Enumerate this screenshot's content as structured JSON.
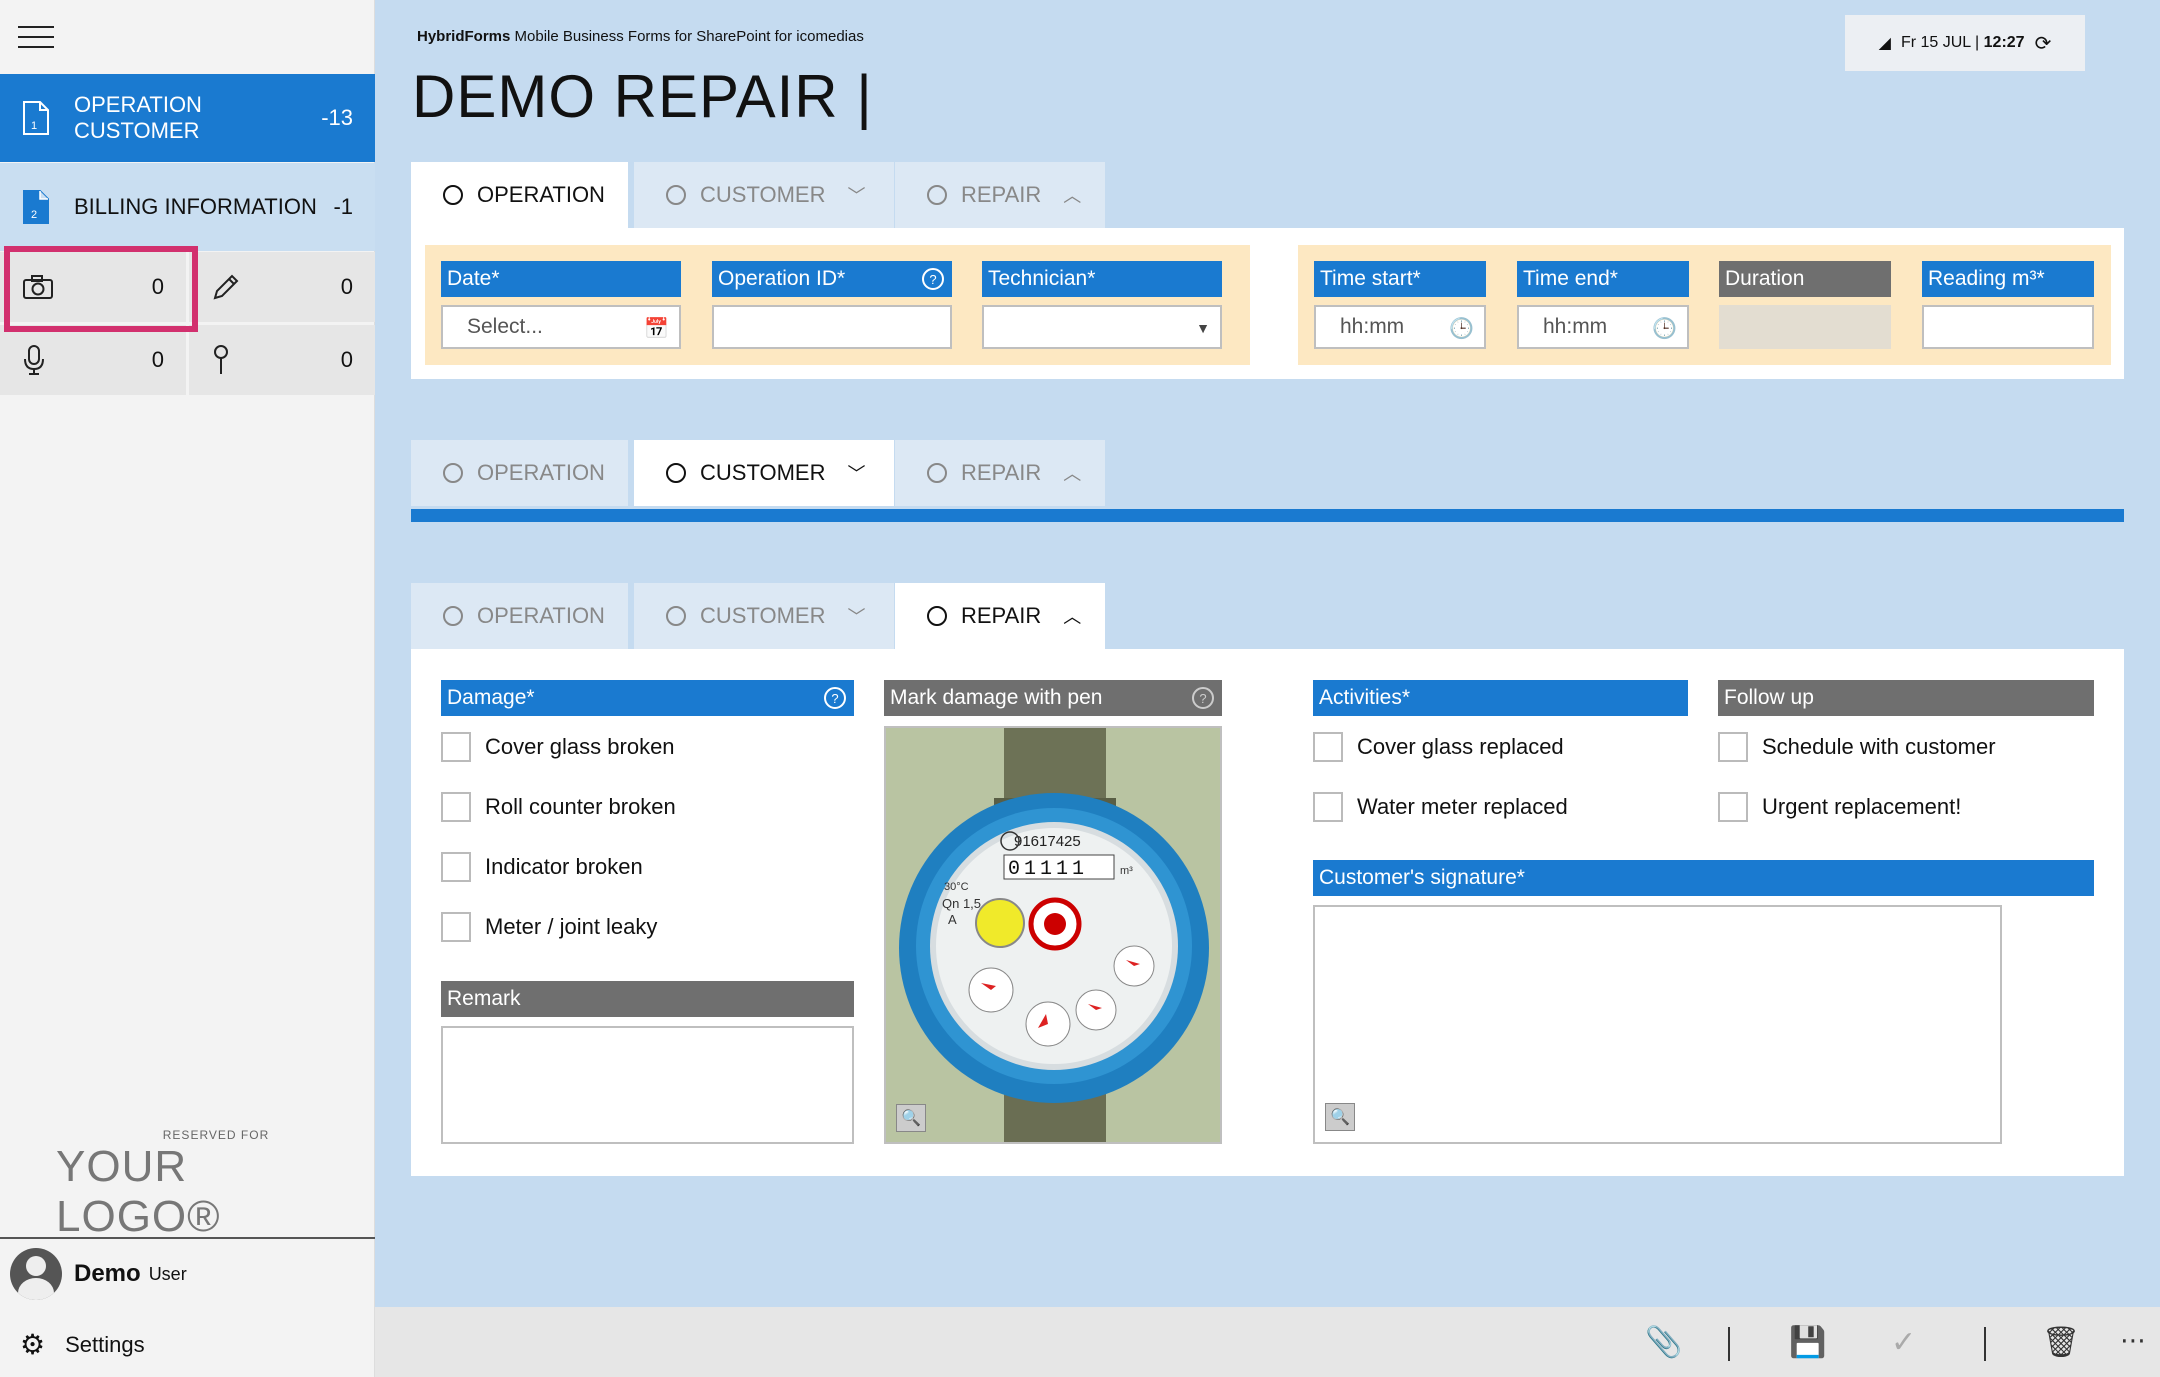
{
  "sidebar": {
    "nav": [
      {
        "num": "1",
        "label": "OPERATION CUSTOMER",
        "count": "-13"
      },
      {
        "num": "2",
        "label": "BILLING INFORMATION",
        "count": "-1"
      }
    ],
    "counters": {
      "camera": "0",
      "pen": "0",
      "mic": "0",
      "pin": "0"
    },
    "logo": {
      "small": "RESERVED FOR",
      "big": "YOUR LOGO®"
    },
    "user": {
      "name": "Demo",
      "role": "User"
    },
    "settings_label": "Settings"
  },
  "header": {
    "brand_bold": "HybridForms",
    "brand_rest": " Mobile Business Forms for SharePoint for icomedias",
    "title": "DEMO REPAIR |",
    "status_date": "Fr 15 JUL | ",
    "status_time": "12:27"
  },
  "tabs": {
    "operation": "OPERATION",
    "customer": "CUSTOMER",
    "repair": "REPAIR"
  },
  "operation": {
    "date_label": "Date*",
    "date_placeholder": "Select...",
    "opid_label": "Operation ID*",
    "tech_label": "Technician*",
    "time_start_label": "Time start*",
    "time_end_label": "Time end*",
    "time_placeholder": "hh:mm",
    "duration_label": "Duration",
    "reading_label": "Reading m³*"
  },
  "repair": {
    "damage_label": "Damage*",
    "damage_options": [
      "Cover glass broken",
      "Roll counter broken",
      "Indicator broken",
      "Meter / joint leaky"
    ],
    "remark_label": "Remark",
    "mark_label": "Mark damage with pen",
    "activities_label": "Activities*",
    "activities_options": [
      "Cover glass replaced",
      "Water meter replaced"
    ],
    "followup_label": "Follow up",
    "followup_options": [
      "Schedule with customer",
      "Urgent replacement!"
    ],
    "signature_label": "Customer's signature*",
    "meter_serial": "91617425",
    "meter_reading": "01111",
    "meter_unit": "m³",
    "meter_qn": "Qn 1,5",
    "meter_a": "A",
    "meter_temp": "30°C"
  },
  "colors": {
    "accent": "#1a7ad0",
    "highlight": "#d2306e",
    "group_bg": "#fde8c2"
  }
}
